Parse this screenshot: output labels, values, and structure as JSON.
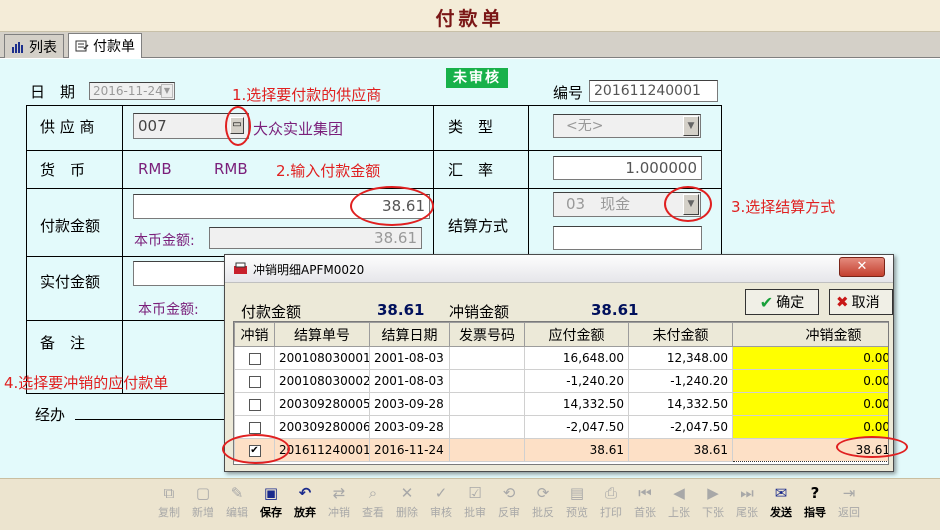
{
  "window": {
    "title": "付款单"
  },
  "tabs": [
    {
      "label": "列表",
      "icon": "bar-chart-icon"
    },
    {
      "label": "付款单",
      "icon": "form-icon"
    }
  ],
  "form": {
    "date_label": "日　期",
    "date_value": "2016-11-24",
    "status": "未审核",
    "number_label": "编号",
    "number_value": "201611240001",
    "supplier_label": "供 应 商",
    "supplier_code": "007",
    "supplier_name": "大众实业集团",
    "type_label": "类　型",
    "type_value": "<无>",
    "currency_label": "货　币",
    "currency_code": "RMB",
    "currency_name": "RMB",
    "rate_label": "汇　率",
    "rate_value": "1.000000",
    "amount_label": "付款金额",
    "amount_value": "38.61",
    "local_amount_label": "本币金额:",
    "local_amount_value": "38.61",
    "settle_label": "结算方式",
    "settle_value": "03　现金",
    "actual_label": "实付金额",
    "actual_local_label": "本币金额:",
    "remark_label": "备　注",
    "handler_label": "经办"
  },
  "annotations": {
    "step1": "1.选择要付款的供应商",
    "step2": "2.输入付款金额",
    "step3": "3.选择结算方式",
    "step4": "4.选择要冲销的应付款单"
  },
  "dialog": {
    "title": "冲销明细APFM0020",
    "pay_amount_label": "付款金额",
    "pay_amount_value": "38.61",
    "offset_amount_label": "冲销金额",
    "offset_amount_value": "38.61",
    "ok_label": "确定",
    "cancel_label": "取消",
    "columns": [
      "冲销",
      "结算单号",
      "结算日期",
      "发票号码",
      "应付金额",
      "未付金额",
      "冲销金额"
    ],
    "rows": [
      {
        "checked": false,
        "no": "200108030001",
        "date": "2001-08-03",
        "invoice": "",
        "payable": "16,648.00",
        "unpaid": "12,348.00",
        "offset": "0.00"
      },
      {
        "checked": false,
        "no": "200108030002",
        "date": "2001-08-03",
        "invoice": "",
        "payable": "-1,240.20",
        "unpaid": "-1,240.20",
        "offset": "0.00"
      },
      {
        "checked": false,
        "no": "200309280005",
        "date": "2003-09-28",
        "invoice": "",
        "payable": "14,332.50",
        "unpaid": "14,332.50",
        "offset": "0.00"
      },
      {
        "checked": false,
        "no": "200309280006",
        "date": "2003-09-28",
        "invoice": "",
        "payable": "-2,047.50",
        "unpaid": "-2,047.50",
        "offset": "0.00"
      },
      {
        "checked": true,
        "no": "201611240001",
        "date": "2016-11-24",
        "invoice": "",
        "payable": "38.61",
        "unpaid": "38.61",
        "offset": "38.61"
      }
    ]
  },
  "toolbar": [
    {
      "label": "复制",
      "icon": "copy-icon",
      "enabled": false
    },
    {
      "label": "新增",
      "icon": "new-icon",
      "enabled": false
    },
    {
      "label": "编辑",
      "icon": "edit-icon",
      "enabled": false
    },
    {
      "label": "保存",
      "icon": "save-icon",
      "enabled": true
    },
    {
      "label": "放弃",
      "icon": "undo-icon",
      "enabled": true
    },
    {
      "label": "冲销",
      "icon": "offset-icon",
      "enabled": false
    },
    {
      "label": "查看",
      "icon": "view-icon",
      "enabled": false
    },
    {
      "label": "删除",
      "icon": "delete-icon",
      "enabled": false
    },
    {
      "label": "审核",
      "icon": "audit-icon",
      "enabled": false
    },
    {
      "label": "批审",
      "icon": "batch-audit-icon",
      "enabled": false
    },
    {
      "label": "反审",
      "icon": "unaudit-icon",
      "enabled": false
    },
    {
      "label": "批反",
      "icon": "batch-unaudit-icon",
      "enabled": false
    },
    {
      "label": "预览",
      "icon": "preview-icon",
      "enabled": false
    },
    {
      "label": "打印",
      "icon": "print-icon",
      "enabled": false
    },
    {
      "label": "首张",
      "icon": "first-icon",
      "enabled": false
    },
    {
      "label": "上张",
      "icon": "prev-icon",
      "enabled": false
    },
    {
      "label": "下张",
      "icon": "next-icon",
      "enabled": false
    },
    {
      "label": "尾张",
      "icon": "last-icon",
      "enabled": false
    },
    {
      "label": "发送",
      "icon": "send-icon",
      "enabled": true
    },
    {
      "label": "指导",
      "icon": "help-icon",
      "enabled": true
    },
    {
      "label": "返回",
      "icon": "exit-icon",
      "enabled": false
    }
  ],
  "colors": {
    "form_bg": "#e3fafb",
    "status_green": "#18b14a",
    "annotation_red": "#e02020",
    "offset_yellow": "#ffff00",
    "selected_row": "#fde0c6",
    "title_red": "#7a1616"
  }
}
